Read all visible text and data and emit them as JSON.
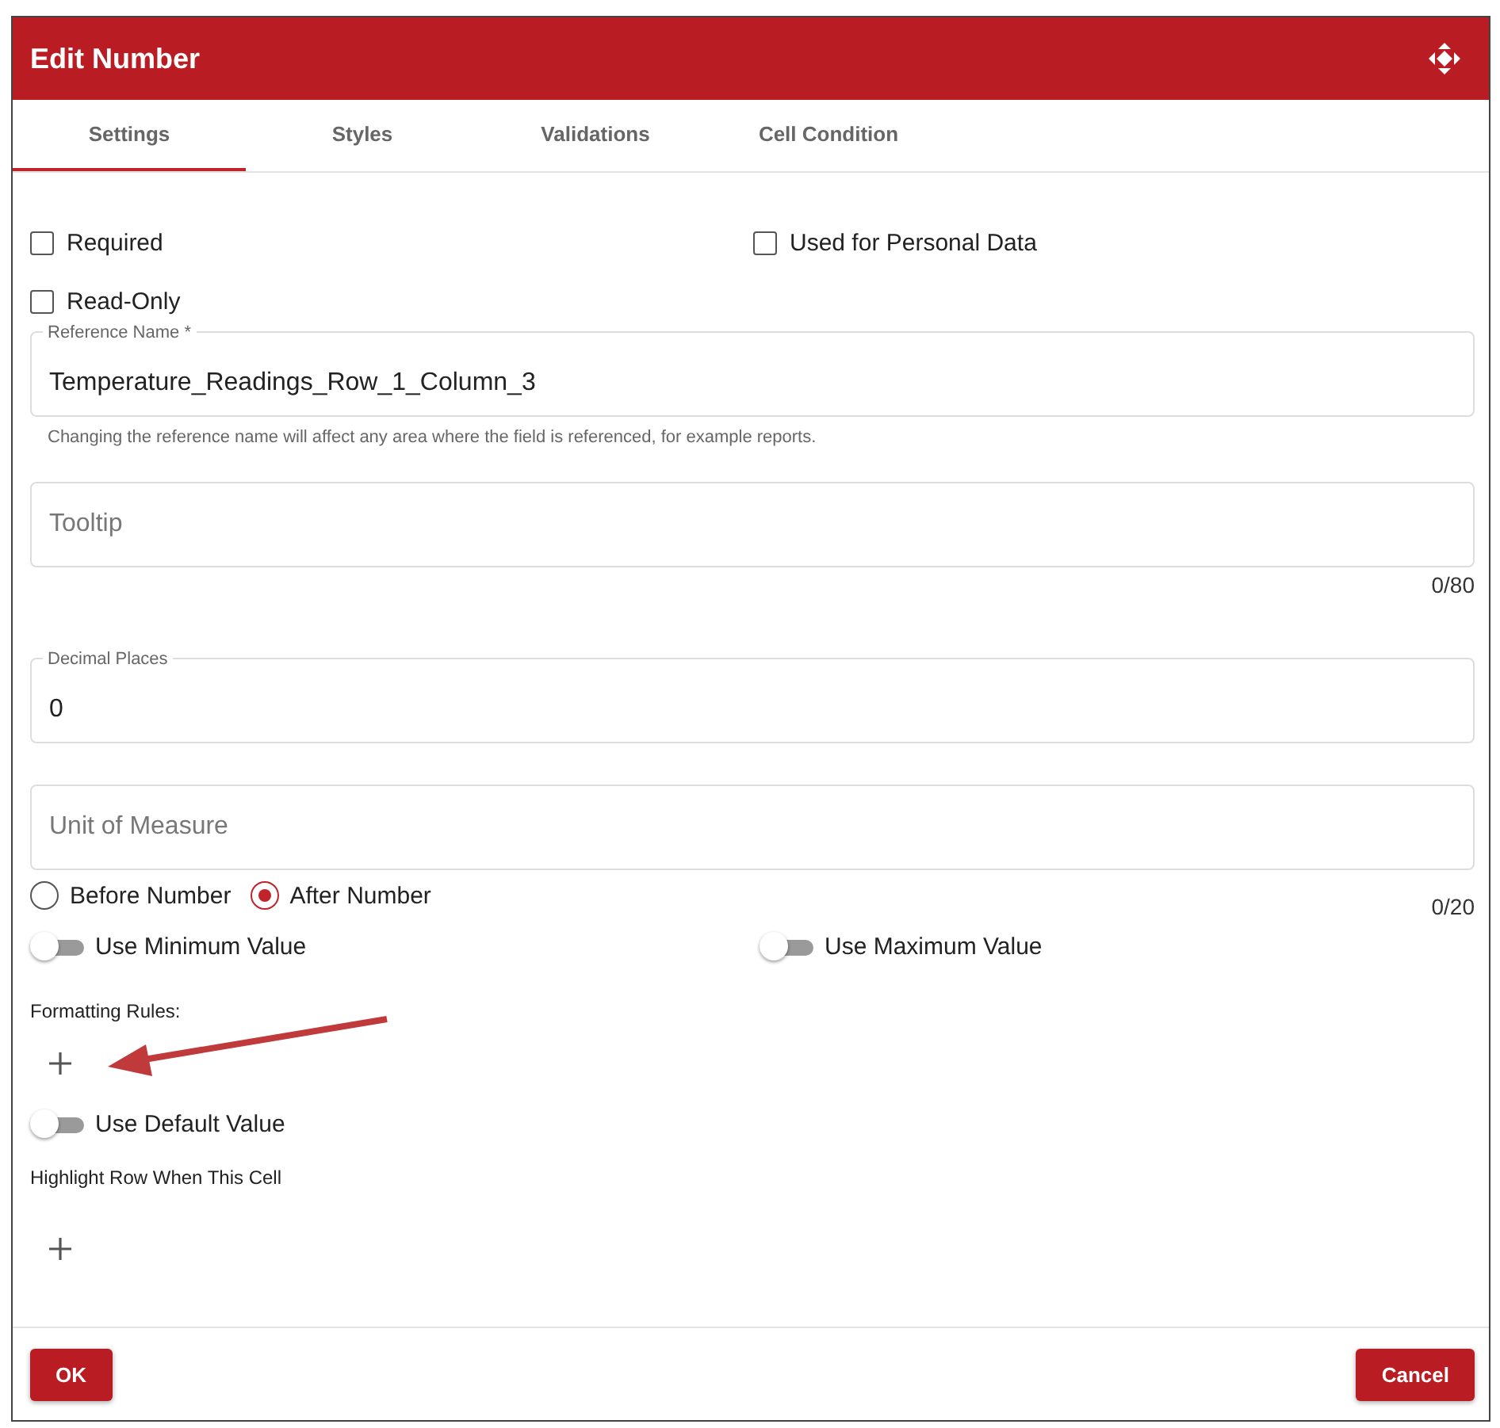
{
  "window": {
    "title": "Edit Number"
  },
  "tabs": [
    {
      "label": "Settings",
      "selected": true
    },
    {
      "label": "Styles",
      "selected": false
    },
    {
      "label": "Validations",
      "selected": false
    },
    {
      "label": "Cell Condition",
      "selected": false
    }
  ],
  "checkboxes": [
    {
      "label": "Required",
      "checked": false
    },
    {
      "label": "Used for Personal Data",
      "checked": false
    },
    {
      "label": "Read-Only",
      "checked": false
    }
  ],
  "reference_name": {
    "label": "Reference Name *",
    "value": "Temperature_Readings_Row_1_Column_3",
    "hint": "Changing the reference name will affect any area where the field is referenced, for example reports."
  },
  "tooltip": {
    "placeholder": "Tooltip",
    "counter": "0/80"
  },
  "decimal_places": {
    "label": "Decimal Places",
    "value": "0"
  },
  "unit_of_measure": {
    "placeholder": "Unit of Measure",
    "counter": "0/20"
  },
  "unit_position": [
    {
      "label": "Before Number",
      "selected": false
    },
    {
      "label": "After Number",
      "selected": true
    }
  ],
  "limit_toggles": [
    {
      "label": "Use Minimum Value",
      "on": false
    },
    {
      "label": "Use Maximum Value",
      "on": false
    }
  ],
  "formatting_rules": {
    "label": "Formatting Rules:"
  },
  "default_toggle": {
    "label": "Use Default Value",
    "on": false
  },
  "highlight_row": {
    "label": "Highlight Row When This Cell"
  },
  "buttons": [
    {
      "label": "OK"
    },
    {
      "label": "Cancel"
    }
  ]
}
